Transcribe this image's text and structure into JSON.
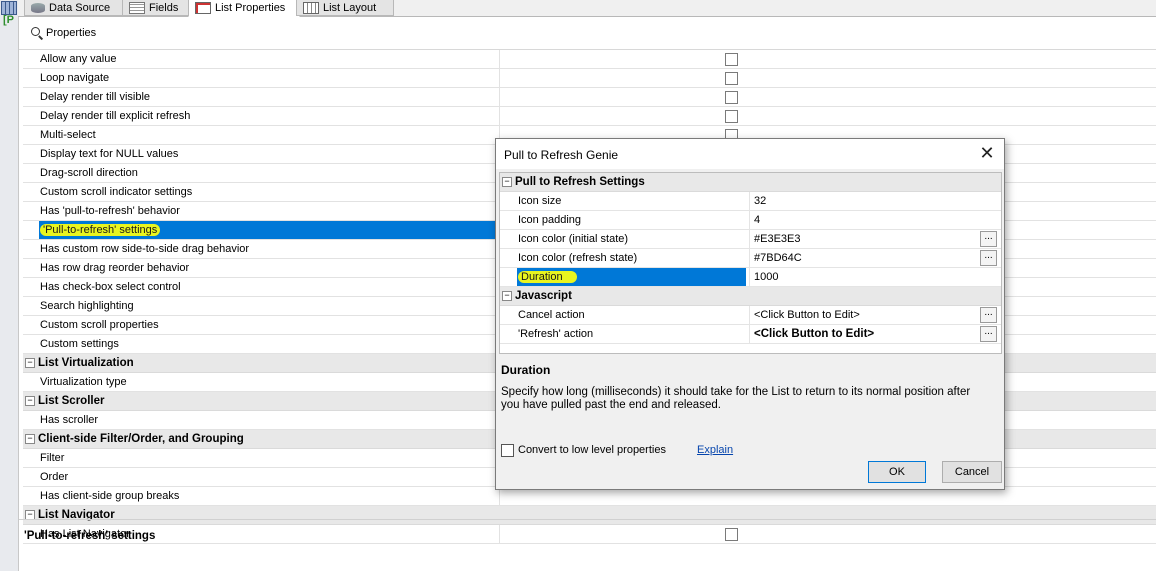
{
  "tabs": [
    {
      "label": "Data Source",
      "icon": "database-icon"
    },
    {
      "label": "Fields",
      "icon": "fields-icon"
    },
    {
      "label": "List Properties",
      "icon": "properties-icon",
      "active": true
    },
    {
      "label": "List Layout",
      "icon": "layout-icon"
    }
  ],
  "left_strip": {
    "bracket": "[P"
  },
  "properties": {
    "header": "Properties",
    "rows": [
      {
        "label": "Allow any value",
        "checkbox": true
      },
      {
        "label": "Loop navigate",
        "checkbox": true
      },
      {
        "label": "Delay render till visible",
        "checkbox": true
      },
      {
        "label": "Delay render till explicit refresh",
        "checkbox": true
      },
      {
        "label": "Multi-select",
        "checkbox": true
      },
      {
        "label": "Display text for NULL values"
      },
      {
        "label": "Drag-scroll direction"
      },
      {
        "label": "Custom scroll indicator settings"
      },
      {
        "label": "Has 'pull-to-refresh' behavior"
      },
      {
        "label": "'Pull-to-refresh' settings",
        "selected": true
      },
      {
        "label": "Has custom row side-to-side drag behavior"
      },
      {
        "label": "Has row drag reorder behavior"
      },
      {
        "label": "Has check-box select control"
      },
      {
        "label": "Search highlighting"
      },
      {
        "label": "Custom scroll properties"
      },
      {
        "label": "Custom settings"
      }
    ],
    "categories": [
      {
        "label": "List Virtualization",
        "rows": [
          {
            "label": "Virtualization type"
          }
        ]
      },
      {
        "label": "List Scroller",
        "rows": [
          {
            "label": "Has scroller"
          }
        ]
      },
      {
        "label": "Client-side Filter/Order, and Grouping",
        "rows": [
          {
            "label": "Filter"
          },
          {
            "label": "Order"
          },
          {
            "label": "Has client-side group breaks"
          }
        ]
      },
      {
        "label": "List Navigator",
        "rows": [
          {
            "label": "Has List Navigator",
            "checkbox": true
          }
        ]
      }
    ],
    "description_title": "'Pull-to-refresh' settings"
  },
  "dialog": {
    "title": "Pull to Refresh Genie",
    "close": "✕",
    "section1": {
      "label": "Pull to Refresh Settings",
      "rows": [
        {
          "name": "Icon size",
          "value": "32"
        },
        {
          "name": "Icon padding",
          "value": "4"
        },
        {
          "name": "Icon color (initial state)",
          "value": "#E3E3E3",
          "ellipsis": true
        },
        {
          "name": "Icon color (refresh state)",
          "value": "#7BD64C",
          "ellipsis": true
        },
        {
          "name": "Duration",
          "value": "1000",
          "selected": true
        }
      ]
    },
    "section2": {
      "label": "Javascript",
      "rows": [
        {
          "name": "Cancel action",
          "value": "<Click Button to Edit>",
          "ellipsis": true
        },
        {
          "name": "'Refresh' action",
          "value": "<Click Button to Edit>",
          "ellipsis": true,
          "bold": true
        }
      ]
    },
    "desc_title": "Duration",
    "desc_text": "Specify how long (milliseconds) it should take for the List to return to its normal position after you have pulled past the end and released.",
    "convert_label": "Convert to low level properties",
    "explain": "Explain",
    "ok": "OK",
    "cancel": "Cancel",
    "ellipsis": "..."
  },
  "colors": {
    "selection": "#0078d7",
    "highlight": "#e9f51f",
    "link": "#0645ad"
  }
}
